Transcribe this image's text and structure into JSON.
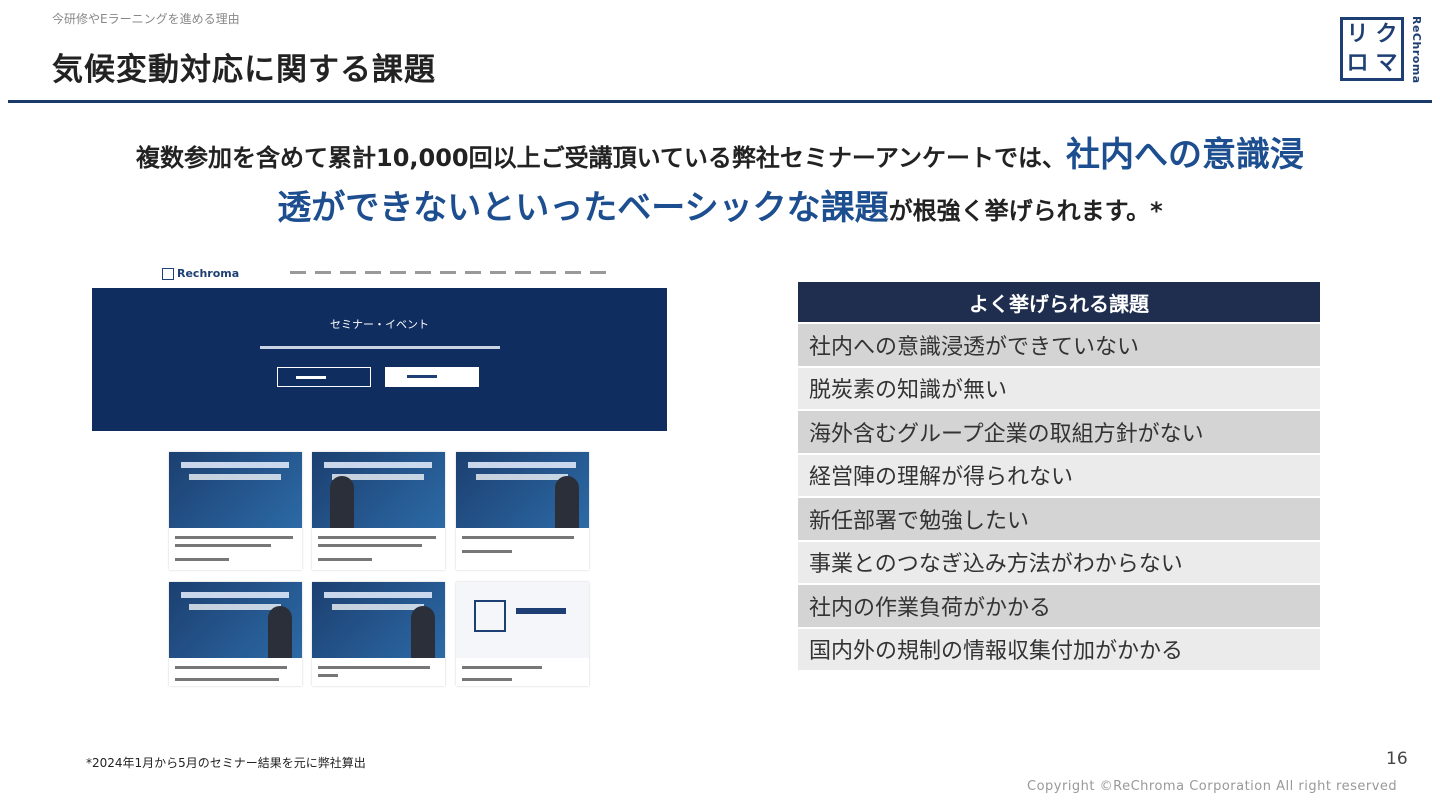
{
  "header": {
    "kicker": "今研修やEラーニングを進める理由",
    "title": "気候変動対応に関する課題",
    "logo": {
      "chars": [
        "リ",
        "ク",
        "ロ",
        "マ"
      ],
      "side_text": "ReChroma"
    }
  },
  "lead": {
    "line1_normal": "複数参加を含めて累計10,000回以上ご受講頂いている弊社セミナーアンケートでは、",
    "line1_emphasis": "社内への意識浸",
    "line2_emphasis": "透ができないといったベーシックな課題",
    "line2_normal": "が根強く挙げられます。*"
  },
  "screenshot": {
    "brand": "Rechroma",
    "hero_title": "セミナー・イベント"
  },
  "table": {
    "header": "よく挙げられる課題",
    "rows": [
      "社内への意識浸透ができていない",
      "脱炭素の知識が無い",
      "海外含むグループ企業の取組方針がない",
      "経営陣の理解が得られない",
      "新任部署で勉強したい",
      "事業とのつなぎ込み方法がわからない",
      "社内の作業負荷がかかる",
      "国内外の規制の情報収集付加がかかる"
    ]
  },
  "footer": {
    "footnote": "*2024年1月から5月のセミナー結果を元に弊社算出",
    "page_number": "16",
    "copyright": "Copyright ©ReChroma Corporation All right reserved"
  },
  "colors": {
    "accent": "#1d4e8f",
    "navy": "#1f2d4e",
    "rule": "#1a3a6b"
  }
}
